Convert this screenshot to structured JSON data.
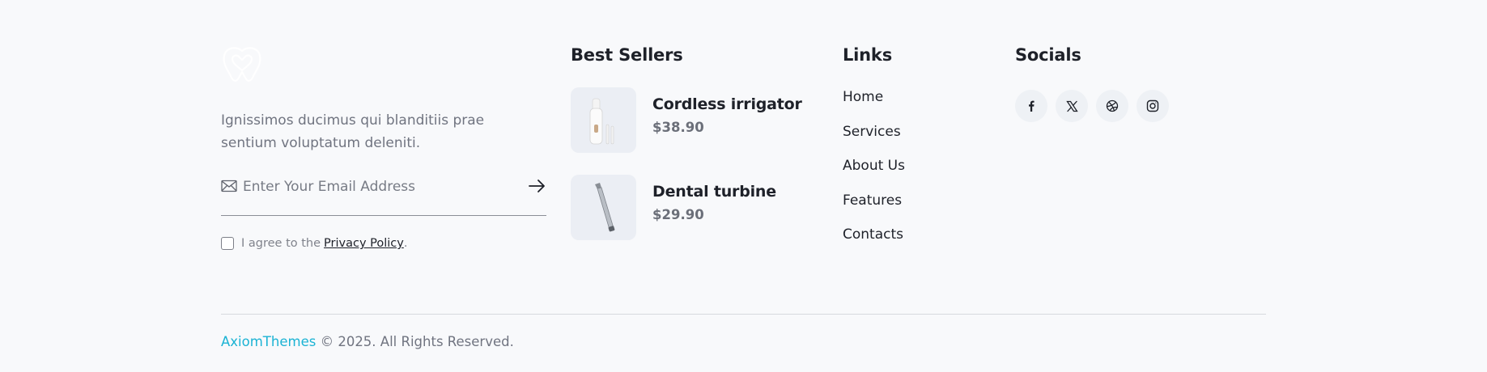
{
  "brand": {
    "logo_icon": "tooth-heart-icon",
    "description": "Ignissimos ducimus qui blanditiis prae sentium voluptatum deleniti."
  },
  "subscribe": {
    "mail_icon": "envelope-icon",
    "email_placeholder": "Enter Your Email Address",
    "email_value": "",
    "submit_icon": "arrow-right-icon",
    "agree_text": "I agree to the",
    "privacy_link": "Privacy Policy",
    "agree_suffix": ".",
    "checked": false
  },
  "best_sellers": {
    "heading": "Best Sellers",
    "items": [
      {
        "name": "Cordless irrigator",
        "price": "$38.90",
        "image": "irrigator-image"
      },
      {
        "name": "Dental turbine",
        "price": "$29.90",
        "image": "turbine-image"
      }
    ]
  },
  "links": {
    "heading": "Links",
    "items": [
      "Home",
      "Services",
      "About Us",
      "Features",
      "Contacts"
    ]
  },
  "socials": {
    "heading": "Socials",
    "items": [
      {
        "name": "facebook-icon"
      },
      {
        "name": "x-twitter-icon"
      },
      {
        "name": "dribbble-icon"
      },
      {
        "name": "instagram-icon"
      }
    ]
  },
  "copyright": {
    "brand": "AxiomThemes",
    "text": " © 2025. All Rights Reserved."
  },
  "colors": {
    "background": "#f8f9fb",
    "accent": "#1bb3d4",
    "text": "#1e2129",
    "muted": "#707480"
  }
}
